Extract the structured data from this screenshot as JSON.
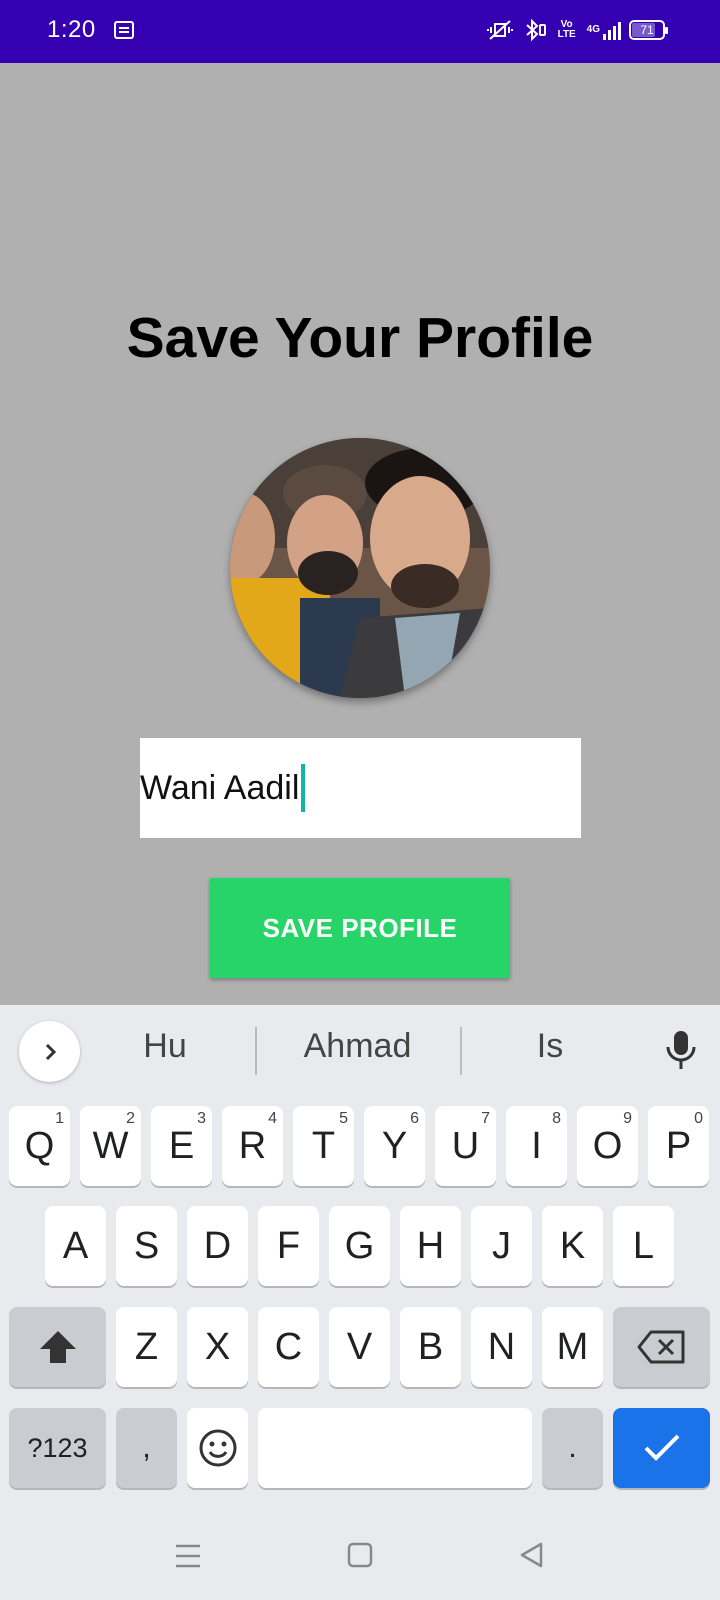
{
  "status_bar": {
    "time": "1:20",
    "network_label": "4G",
    "volte_label": "Vo LTE",
    "battery_level": "71",
    "background": "#3400b2"
  },
  "main": {
    "title": "Save Your Profile",
    "name_value": "Wani Aadil",
    "save_button_label": "SAVE PROFILE",
    "save_button_color": "#26d467",
    "caret_color": "#13b5a8"
  },
  "keyboard": {
    "suggestions": [
      "Hu",
      "Ahmad",
      "Is"
    ],
    "row1": [
      {
        "label": "Q",
        "hint": "1"
      },
      {
        "label": "W",
        "hint": "2"
      },
      {
        "label": "E",
        "hint": "3"
      },
      {
        "label": "R",
        "hint": "4"
      },
      {
        "label": "T",
        "hint": "5"
      },
      {
        "label": "Y",
        "hint": "6"
      },
      {
        "label": "U",
        "hint": "7"
      },
      {
        "label": "I",
        "hint": "8"
      },
      {
        "label": "O",
        "hint": "9"
      },
      {
        "label": "P",
        "hint": "0"
      }
    ],
    "row2": [
      "A",
      "S",
      "D",
      "F",
      "G",
      "H",
      "J",
      "K",
      "L"
    ],
    "row3": [
      "Z",
      "X",
      "C",
      "V",
      "B",
      "N",
      "M"
    ],
    "symbols_label": "?123",
    "comma_label": ",",
    "period_label": ".",
    "enter_color": "#1a73e8"
  }
}
